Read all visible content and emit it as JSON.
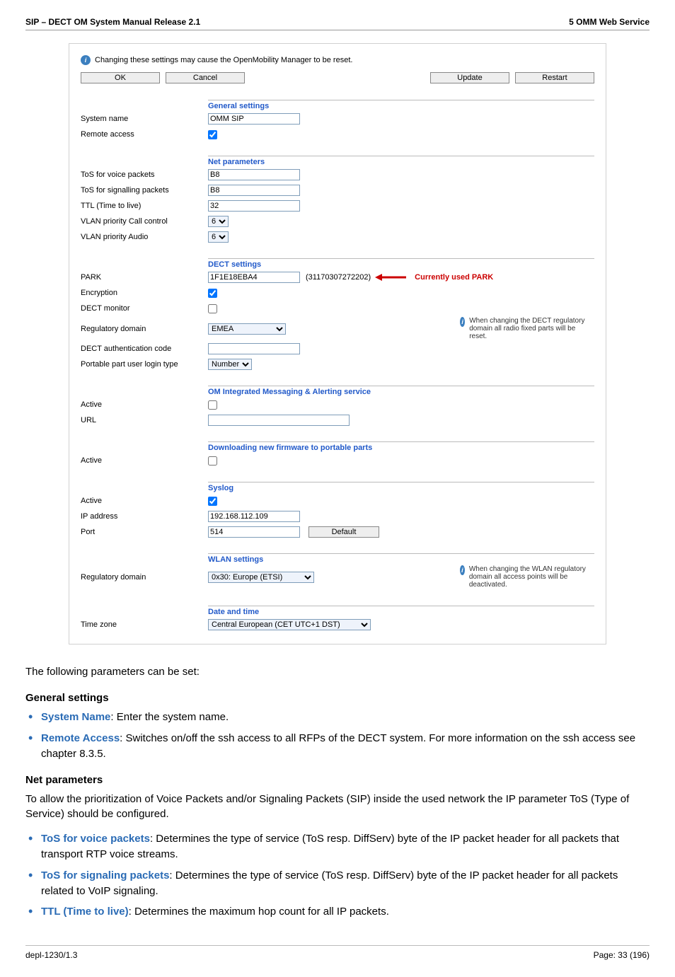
{
  "header": {
    "left": "SIP – DECT OM System Manual Release 2.1",
    "right": "5 OMM Web Service"
  },
  "panel": {
    "info_text": "Changing these settings may cause the OpenMobility Manager to be reset.",
    "buttons": {
      "ok": "OK",
      "cancel": "Cancel",
      "update": "Update",
      "restart": "Restart"
    },
    "general": {
      "title": "General settings",
      "system_name_label": "System name",
      "system_name_value": "OMM SIP",
      "remote_access_label": "Remote access"
    },
    "net": {
      "title": "Net parameters",
      "tos_voice_label": "ToS for voice packets",
      "tos_voice_value": "B8",
      "tos_sig_label": "ToS for signalling packets",
      "tos_sig_value": "B8",
      "ttl_label": "TTL (Time to live)",
      "ttl_value": "32",
      "vlan_call_label": "VLAN priority Call control",
      "vlan_call_value": "6",
      "vlan_audio_label": "VLAN priority Audio",
      "vlan_audio_value": "6"
    },
    "dect": {
      "title": "DECT settings",
      "park_label": "PARK",
      "park_value": "1F1E18EBA4",
      "park_readout": "(31170307272202)",
      "park_flag": "Currently used PARK",
      "encryption_label": "Encryption",
      "monitor_label": "DECT monitor",
      "regdom_label": "Regulatory domain",
      "regdom_value": "EMEA",
      "regdom_note": "When changing the DECT regulatory domain all radio fixed parts will be reset.",
      "auth_label": "DECT authentication code",
      "login_label": "Portable part user login type",
      "login_value": "Number"
    },
    "om_msg": {
      "title": "OM Integrated Messaging & Alerting service",
      "active_label": "Active",
      "url_label": "URL"
    },
    "dl_fw": {
      "title": "Downloading new firmware to portable parts",
      "active_label": "Active"
    },
    "syslog": {
      "title": "Syslog",
      "active_label": "Active",
      "ip_label": "IP address",
      "ip_value": "192.168.112.109",
      "port_label": "Port",
      "port_value": "514",
      "default_btn": "Default"
    },
    "wlan": {
      "title": "WLAN settings",
      "regdom_label": "Regulatory domain",
      "regdom_value": "0x30: Europe (ETSI)",
      "note": "When changing the WLAN regulatory domain all access points will be deactivated."
    },
    "datetime": {
      "title": "Date and time",
      "tz_label": "Time zone",
      "tz_value": "Central European (CET UTC+1 DST)"
    }
  },
  "body": {
    "intro": "The following parameters can be set:",
    "general_head": "General settings",
    "b1_term": "System Name",
    "b1_rest": ": Enter the system name.",
    "b2_term": "Remote Access",
    "b2_rest": ": Switches on/off the ssh access to all RFPs of the DECT system. For more information on the ssh access see chapter 8.3.5.",
    "net_head": "Net parameters",
    "net_para": "To allow the prioritization of Voice Packets and/or Signaling Packets (SIP) inside the used network the IP parameter ToS (Type of Service) should be configured.",
    "b3_term": "ToS for voice packets",
    "b3_rest": ": Determines the type of service (ToS resp. DiffServ) byte of the IP packet header for all packets that transport RTP voice streams.",
    "b4_term": "ToS for signaling packets",
    "b4_rest": ": Determines the type of service (ToS resp. DiffServ) byte of the IP packet header for all packets related to VoIP signaling.",
    "b5_term": "TTL (Time to live)",
    "b5_rest": ": Determines the maximum hop count for all IP packets."
  },
  "footer": {
    "left": "depl-1230/1.3",
    "right": "Page: 33 (196)"
  }
}
